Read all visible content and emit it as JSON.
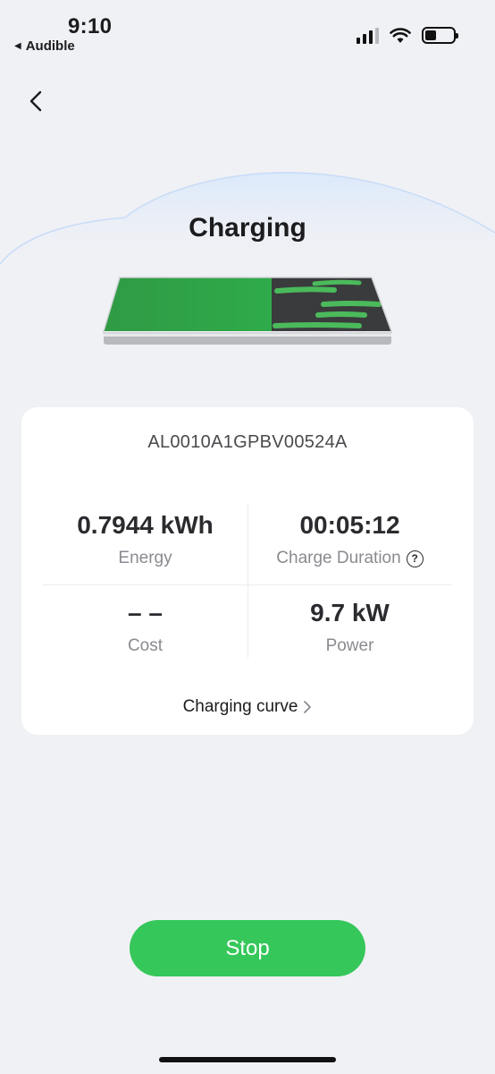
{
  "status_bar": {
    "time": "9:10",
    "back_app": "Audible",
    "back_arrow": "◀"
  },
  "nav": {
    "back_icon": "chevron-left-icon"
  },
  "hero": {
    "title": "Charging"
  },
  "card": {
    "serial": "AL0010A1GPBV00524A",
    "metrics": {
      "energy_value": "0.7944 kWh",
      "energy_label": "Energy",
      "duration_value": "00:05:12",
      "duration_label": "Charge Duration",
      "cost_value": "– –",
      "cost_label": "Cost",
      "power_value": "9.7 kW",
      "power_label": "Power"
    },
    "curve_link": "Charging curve"
  },
  "actions": {
    "stop_label": "Stop"
  },
  "colors": {
    "accent_green": "#35c75a",
    "background": "#f0f1f5"
  }
}
